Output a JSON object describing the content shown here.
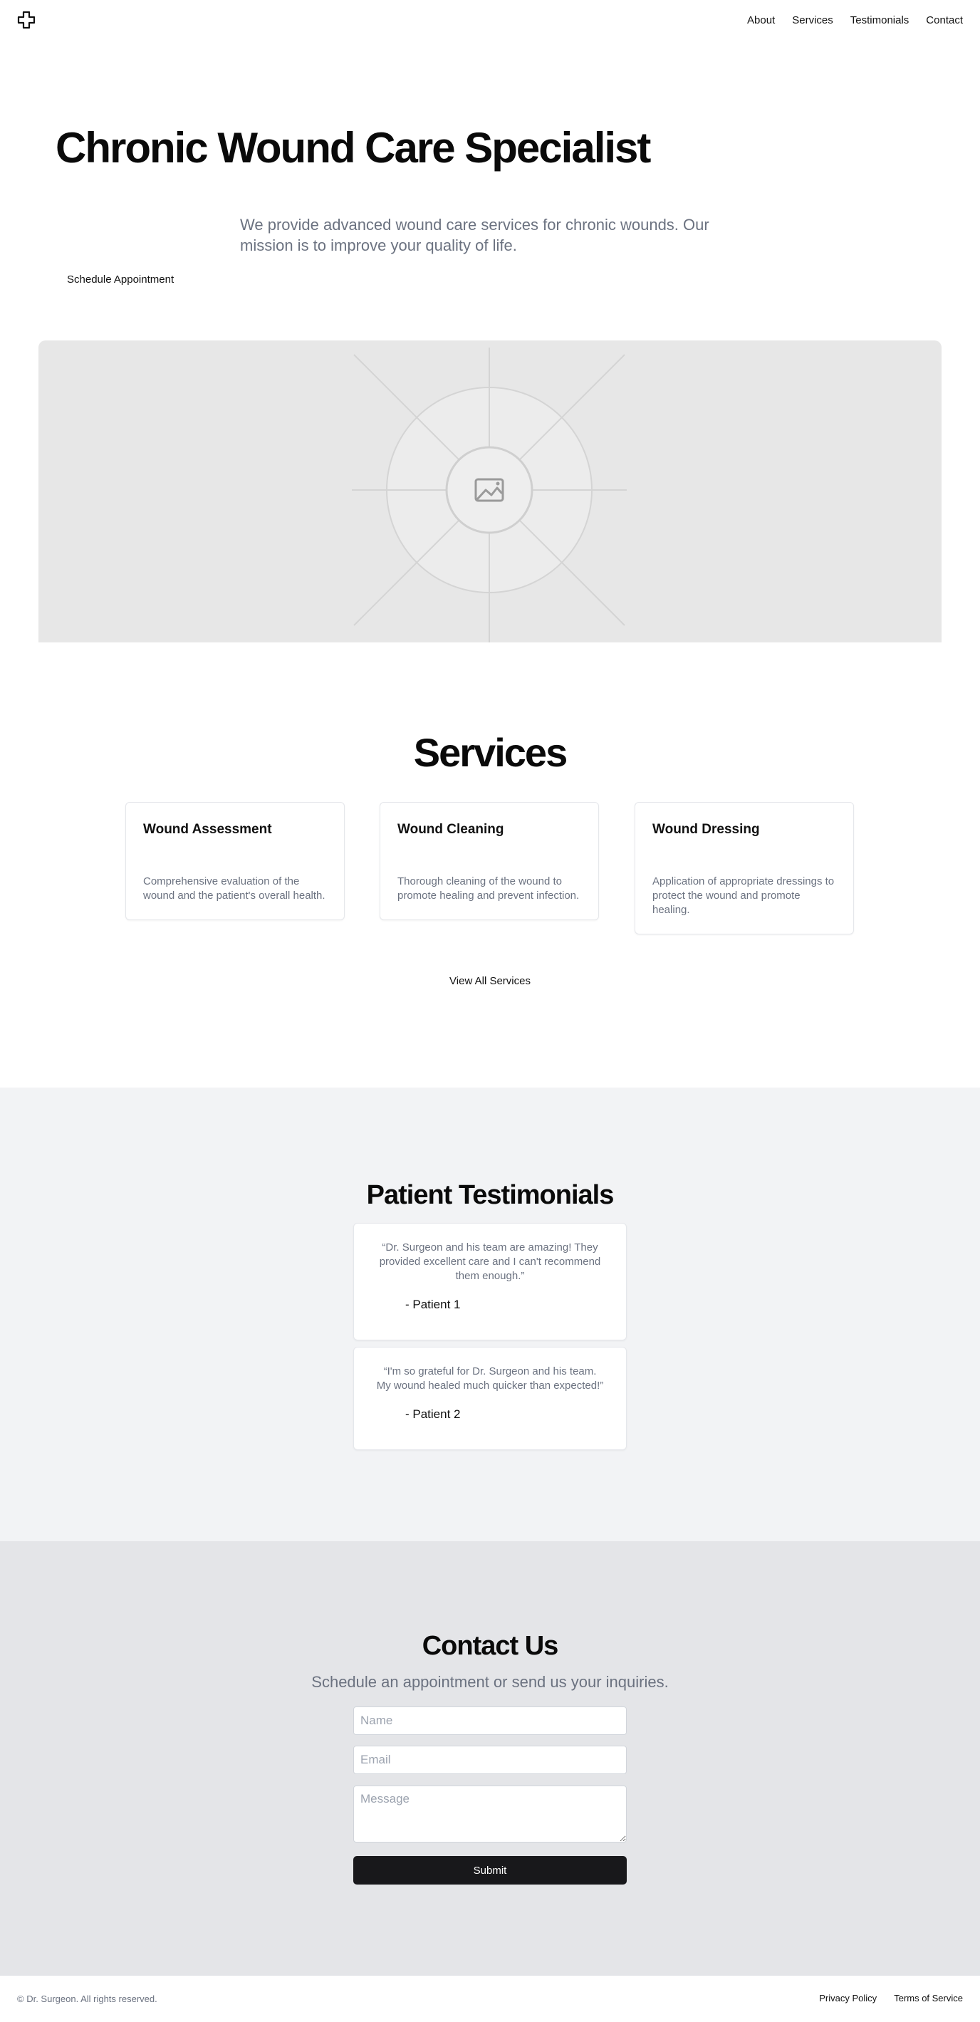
{
  "header": {
    "logo_icon": "medical-cross-icon",
    "nav": [
      "About",
      "Services",
      "Testimonials",
      "Contact"
    ]
  },
  "hero": {
    "title": "Chronic Wound Care Specialist",
    "subtitle": "We provide advanced wound care services for chronic wounds. Our mission is to improve your quality of life.",
    "cta": "Schedule Appointment",
    "image_icon": "image-placeholder-icon"
  },
  "services": {
    "title": "Services",
    "items": [
      {
        "title": "Wound Assessment",
        "description": "Comprehensive evaluation of the wound and the patient's overall health."
      },
      {
        "title": "Wound Cleaning",
        "description": "Thorough cleaning of the wound to promote healing and prevent infection."
      },
      {
        "title": "Wound Dressing",
        "description": "Application of appropriate dressings to protect the wound and promote healing."
      }
    ],
    "view_all": "View All Services"
  },
  "testimonials": {
    "title": "Patient Testimonials",
    "items": [
      {
        "quote": "“Dr. Surgeon and his team are amazing! They provided excellent care and I can't recommend them enough.”",
        "author": "- Patient 1"
      },
      {
        "quote": "“I'm so grateful for Dr. Surgeon and his team. My wound healed much quicker than expected!”",
        "author": "- Patient 2"
      }
    ]
  },
  "contact": {
    "title": "Contact Us",
    "subtitle": "Schedule an appointment or send us your inquiries.",
    "name_placeholder": "Name",
    "email_placeholder": "Email",
    "message_placeholder": "Message",
    "submit": "Submit"
  },
  "footer": {
    "copyright": "© Dr. Surgeon. All rights reserved.",
    "links": [
      "Privacy Policy",
      "Terms of Service"
    ]
  },
  "colors": {
    "text": "#0a0a0a",
    "muted": "#6b7280",
    "testimonials_bg": "#f2f3f5",
    "contact_bg": "#e4e5e8",
    "button_dark": "#18181b"
  }
}
